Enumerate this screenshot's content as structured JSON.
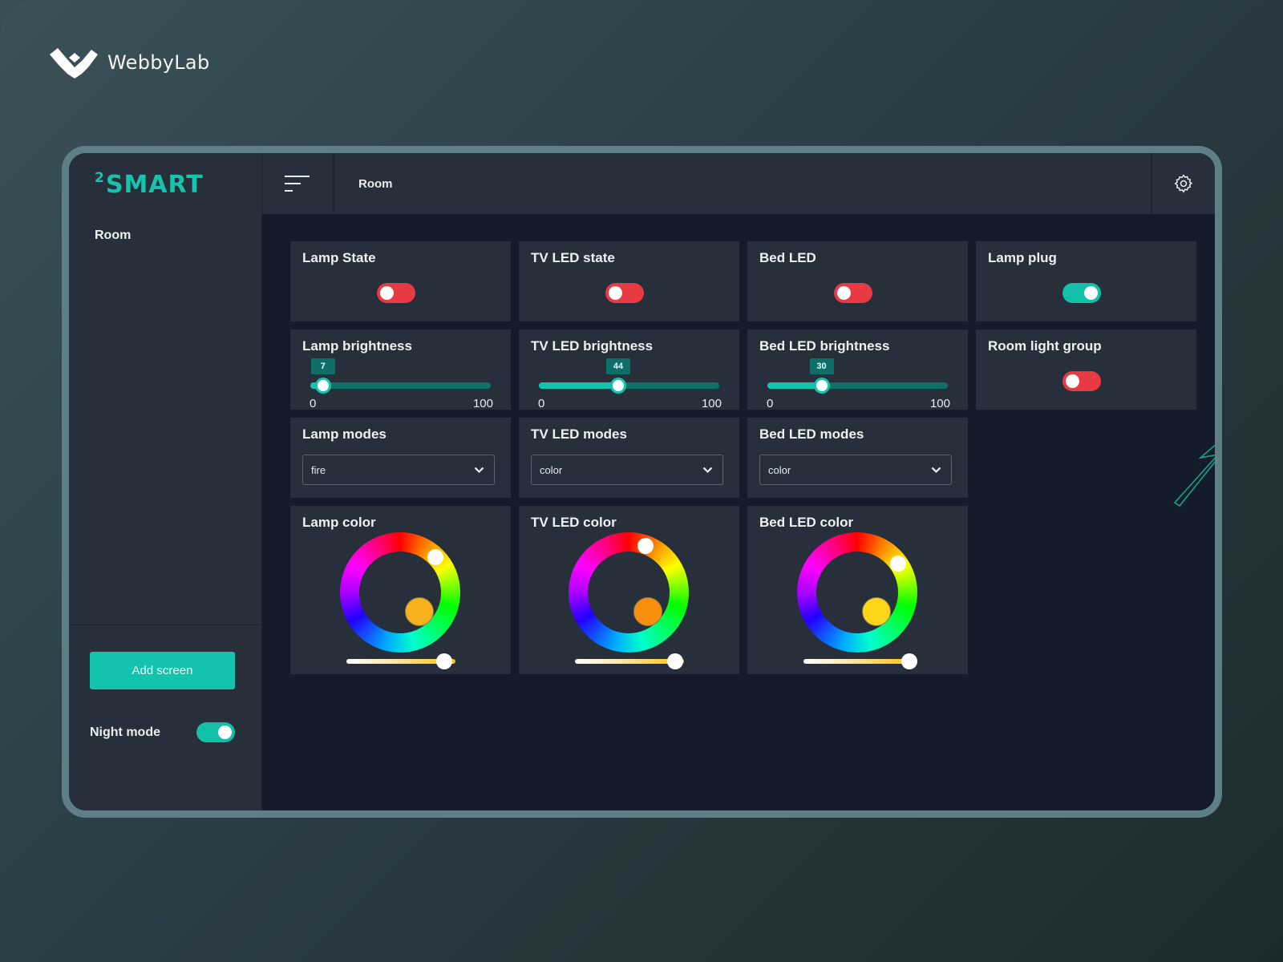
{
  "brand": {
    "name": "WebbyLab",
    "logo_icon": "webbylab-logo-icon"
  },
  "app": {
    "logo_text": "SMART",
    "logo_superscript": "2",
    "accent_color": "#13c3ad",
    "off_color": "#e83a42"
  },
  "sidebar": {
    "items": [
      {
        "label": "Room"
      }
    ],
    "add_screen_label": "Add screen",
    "night_mode": {
      "label": "Night mode",
      "on": true
    }
  },
  "topbar": {
    "menu_icon": "menu-icon",
    "breadcrumb": "Room",
    "settings_icon": "gear-icon"
  },
  "widgets": {
    "lamp_state": {
      "title": "Lamp State",
      "on": false
    },
    "tv_led_state": {
      "title": "TV LED state",
      "on": false
    },
    "bed_led": {
      "title": "Bed LED",
      "on": false
    },
    "lamp_plug": {
      "title": "Lamp plug",
      "on": true
    },
    "lamp_brightness": {
      "title": "Lamp brightness",
      "value": 7,
      "min": "0",
      "max": "100",
      "value_label": "7"
    },
    "tv_led_brightness": {
      "title": "TV LED brightness",
      "value": 44,
      "min": "0",
      "max": "100",
      "value_label": "44"
    },
    "bed_led_brightness": {
      "title": "Bed LED brightness",
      "value": 30,
      "min": "0",
      "max": "100",
      "value_label": "30"
    },
    "room_light_group": {
      "title": "Room light group",
      "on": false
    },
    "lamp_modes": {
      "title": "Lamp modes",
      "selected": "fire"
    },
    "tv_led_modes": {
      "title": "TV LED modes",
      "selected": "color"
    },
    "bed_led_modes": {
      "title": "Bed LED modes",
      "selected": "color"
    },
    "lamp_color": {
      "title": "Lamp color",
      "color": "#f7b21c",
      "hue_deg": 45,
      "temperature_pct": 90
    },
    "tv_led_color": {
      "title": "TV LED color",
      "color": "#fa8e0e",
      "hue_deg": 20,
      "temperature_pct": 92
    },
    "bed_led_color": {
      "title": "Bed LED color",
      "color": "#fdd61a",
      "hue_deg": 55,
      "temperature_pct": 97
    }
  }
}
